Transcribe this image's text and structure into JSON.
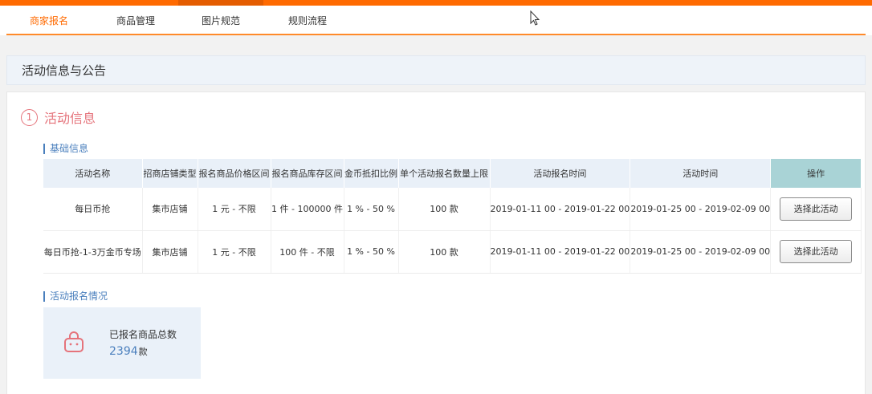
{
  "nav": [
    {
      "label": "商家报名",
      "active": true
    },
    {
      "label": "商品管理",
      "active": false
    },
    {
      "label": "图片规范",
      "active": false
    },
    {
      "label": "规则流程",
      "active": false
    }
  ],
  "section_title": "活动信息与公告",
  "step": {
    "number": "1",
    "label": "活动信息"
  },
  "basic_info_label": "基础信息",
  "table": {
    "headers": [
      "活动名称",
      "招商店铺类型",
      "报名商品价格区间",
      "报名商品库存区间",
      "金币抵扣比例",
      "单个活动报名数量上限",
      "活动报名时间",
      "活动时间",
      "操作"
    ],
    "rows": [
      [
        "每日币抢",
        "集市店铺",
        "1 元 - 不限",
        "1 件 - 100000 件",
        "1 % - 50 %",
        "100 款",
        "2019-01-11 00 - 2019-01-22 00",
        "2019-01-25 00 - 2019-02-09 00",
        "选择此活动"
      ],
      [
        "每日币抢-1-3万金币专场",
        "集市店铺",
        "1 元 - 不限",
        "100 件 - 不限",
        "1 % - 50 %",
        "100 款",
        "2019-01-11 00 - 2019-01-22 00",
        "2019-01-25 00 - 2019-02-09 00",
        "选择此活动"
      ]
    ]
  },
  "signup_label": "活动报名情况",
  "stats": {
    "caption": "已报名商品总数",
    "value": "2394",
    "unit": "款"
  },
  "colors": {
    "brand": "#ff6a00",
    "accent_red": "#e5737b",
    "accent_blue": "#4a7fbd",
    "header_bg": "#e9f0f8",
    "op_header_bg": "#a9d3d6"
  },
  "icons": {
    "cursor": "mouse-pointer-icon",
    "stats": "shopping-bag-icon"
  }
}
